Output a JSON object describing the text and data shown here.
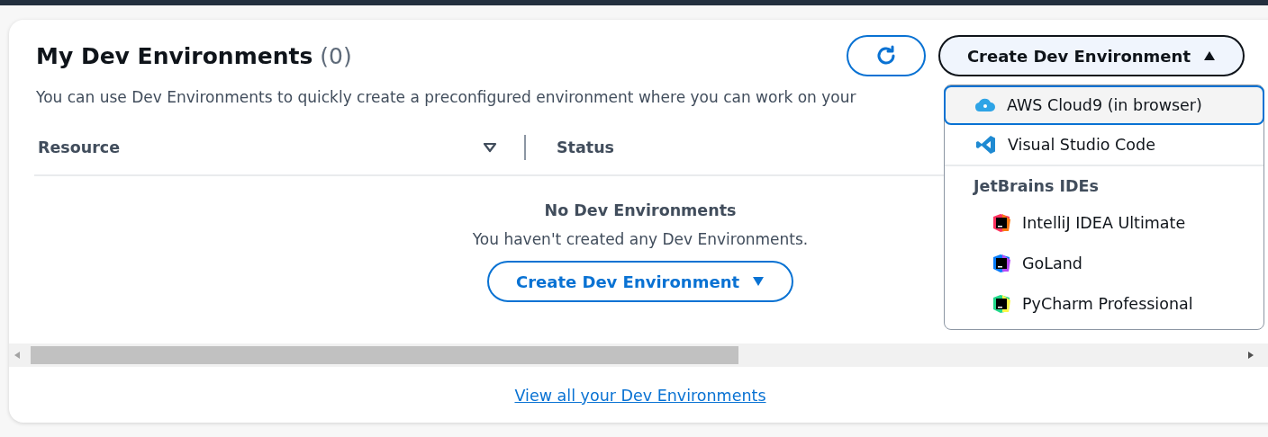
{
  "panel": {
    "title": "My Dev Environments",
    "count": "(0)",
    "description": "You can use Dev Environments to quickly create a preconfigured environment where you can work on your",
    "create_button": {
      "label": "Create Dev Environment",
      "expanded": true
    },
    "table": {
      "columns": [
        {
          "label": "Resource",
          "sortable": true
        },
        {
          "label": "Status",
          "sortable": false
        }
      ]
    },
    "empty_state": {
      "title": "No Dev Environments",
      "message": "You haven't created any Dev Environments.",
      "button": {
        "label": "Create Dev Environment",
        "expanded": false
      }
    },
    "footer_link": "View all your Dev Environments"
  },
  "menu": {
    "items": [
      {
        "kind": "option",
        "label": "AWS Cloud9 (in browser)",
        "selected": true
      },
      {
        "kind": "option",
        "label": "Visual Studio Code",
        "selected": false
      },
      {
        "kind": "group",
        "label": "JetBrains IDEs",
        "children": [
          {
            "label": "IntelliJ IDEA Ultimate",
            "selected": false
          },
          {
            "label": "GoLand",
            "selected": false
          },
          {
            "label": "PyCharm Professional",
            "selected": false
          }
        ]
      }
    ]
  }
}
